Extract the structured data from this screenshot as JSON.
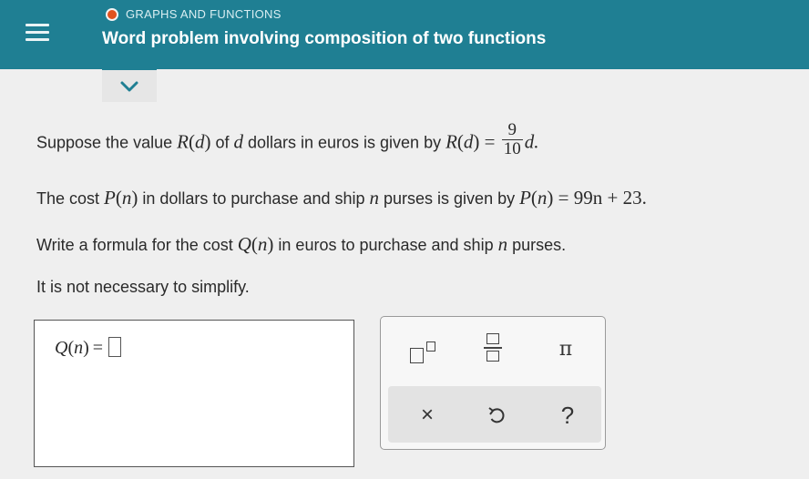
{
  "header": {
    "topic": "GRAPHS AND FUNCTIONS",
    "title": "Word problem involving composition of two functions",
    "status_color": "#e0521f",
    "bar_color": "#1f7f93"
  },
  "question": {
    "l1": {
      "a": "Suppose the value ",
      "fn": "R",
      "arg": "d",
      "b": " of ",
      "var": "d",
      "c": " dollars in euros is given by ",
      "fn2": "R",
      "arg2": "d",
      "eq": " = ",
      "num": "9",
      "den": "10",
      "end": "d."
    },
    "l2": {
      "a": "The cost ",
      "fn": "P",
      "arg": "n",
      "b": " in dollars to purchase and ship ",
      "var": "n",
      "c": " purses is given by ",
      "fn2": "P",
      "arg2": "n",
      "rhs": " = 99n + 23."
    },
    "l3": {
      "a": "Write a formula for the cost ",
      "fn": "Q",
      "arg": "n",
      "b": " in euros to purchase and ship ",
      "var": "n",
      "c": " purses."
    },
    "l4": "It is not necessary to simplify."
  },
  "answer": {
    "fn": "Q",
    "arg": "n",
    "eq": "="
  },
  "palette": {
    "pi": "π",
    "clear": "×",
    "help": "?"
  },
  "icons": {
    "menu": "hamburger-icon",
    "expand": "chevron-down-icon",
    "superscript": "superscript-icon",
    "fraction": "fraction-icon",
    "pi": "pi-icon",
    "clear": "close-icon",
    "undo": "undo-icon",
    "help": "help-icon"
  }
}
